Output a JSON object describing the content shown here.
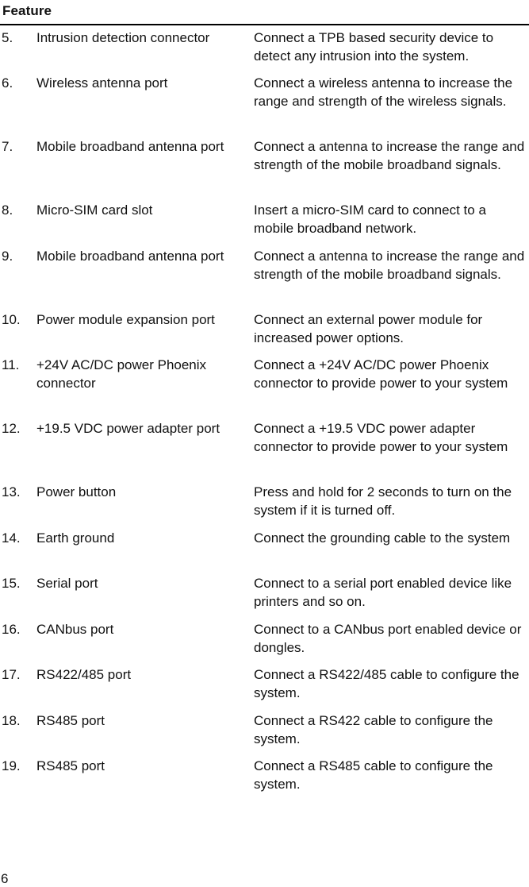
{
  "table": {
    "header": "Feature",
    "rows": [
      {
        "num": "5.",
        "feature": "Intrusion detection connector",
        "description": "Connect a TPB based security device to detect any intrusion into the system."
      },
      {
        "num": "6.",
        "feature": "Wireless antenna port",
        "description": "Connect a wireless antenna to increase the range and strength of the wireless signals."
      },
      {
        "num": "7.",
        "feature": "Mobile broadband antenna port",
        "description": "Connect a antenna to increase the range and strength of the mobile broadband signals."
      },
      {
        "num": "8.",
        "feature": "Micro-SIM card slot",
        "description": "Insert a micro-SIM card to connect to a mobile broadband network."
      },
      {
        "num": "9.",
        "feature": "Mobile broadband antenna port",
        "description": "Connect a antenna to increase the range and strength of the mobile broadband signals."
      },
      {
        "num": "10.",
        "feature": "Power module expansion port",
        "description": "Connect an external power module for increased power options."
      },
      {
        "num": "11.",
        "feature": "+24V AC/DC power Phoenix connector",
        "description": "Connect a +24V AC/DC power Phoenix connector to provide power to your system"
      },
      {
        "num": "12.",
        "feature": "+19.5 VDC power adapter port",
        "description": "Connect a +19.5 VDC power adapter connector to provide power to your system"
      },
      {
        "num": "13.",
        "feature": "Power button",
        "description": "Press and hold for 2 seconds to turn on the system if it is turned off."
      },
      {
        "num": "14.",
        "feature": "Earth ground",
        "description": "Connect the grounding cable to the system"
      },
      {
        "num": "15.",
        "feature": "Serial port",
        "description": "Connect to a serial port enabled device like printers and so on."
      },
      {
        "num": "16.",
        "feature": "CANbus port",
        "description": "Connect to a CANbus port enabled device or dongles."
      },
      {
        "num": "17.",
        "feature": "RS422/485 port",
        "description": "Connect a RS422/485 cable to configure the system."
      },
      {
        "num": "18.",
        "feature": "RS485 port",
        "description": "Connect a RS422 cable to configure the system."
      },
      {
        "num": "19.",
        "feature": "RS485 port",
        "description": "Connect a RS485 cable to configure the system."
      }
    ]
  },
  "page": {
    "number": "6"
  }
}
